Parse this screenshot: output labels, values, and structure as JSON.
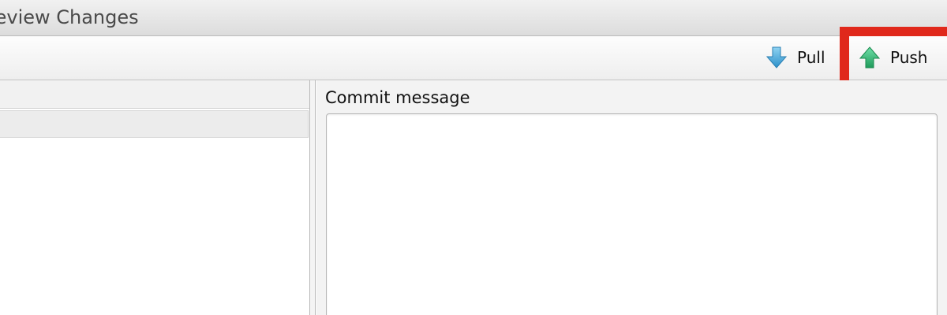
{
  "window": {
    "title": "Review Changes"
  },
  "toolbar": {
    "pull_label": "Pull",
    "push_label": "Push",
    "pull_icon": "arrow-down-icon",
    "push_icon": "arrow-up-icon"
  },
  "commit": {
    "label": "Commit message",
    "value": ""
  },
  "colors": {
    "highlight": "#e0281b",
    "pull_arrow": "#3aa7d8",
    "push_arrow": "#23b36b"
  }
}
